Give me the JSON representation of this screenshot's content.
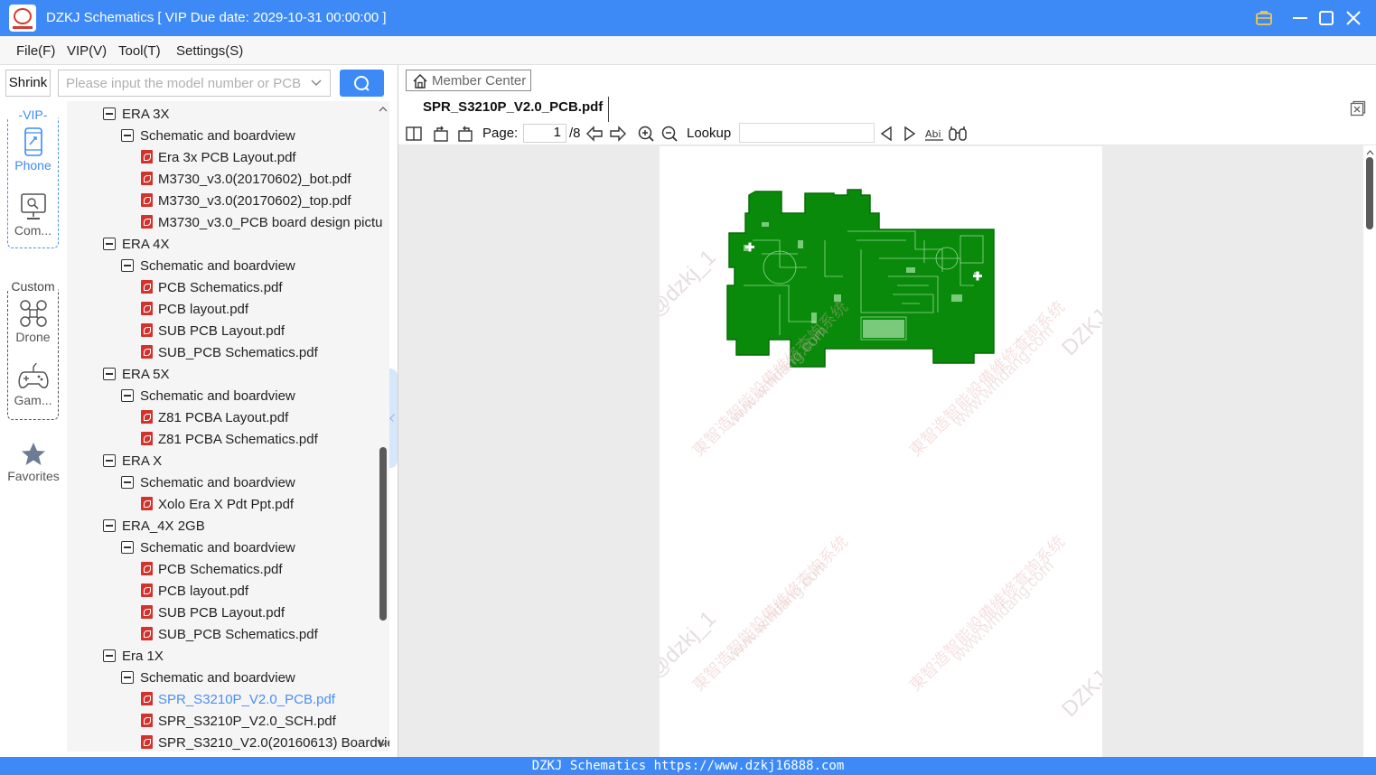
{
  "window": {
    "title": "DZKJ Schematics [ VIP Due date: 2029-10-31 00:00:00 ]",
    "accent_color": "#3d8af7"
  },
  "menu": [
    {
      "label": "File(F)"
    },
    {
      "label": "VIP(V)"
    },
    {
      "label": "Tool(T)"
    },
    {
      "label": "Settings(S)"
    }
  ],
  "toolbar": {
    "shrink_label": "Shrink",
    "search_placeholder": "Please input the model number or PCB",
    "search_value": ""
  },
  "sidenav": {
    "vip_group_label": "-VIP-",
    "custom_group_label": "Custom",
    "items": [
      {
        "label": "Phone",
        "icon": "phone-icon",
        "active": true
      },
      {
        "label": "Com...",
        "icon": "computer-icon"
      },
      {
        "label": "Drone",
        "icon": "drone-icon"
      },
      {
        "label": "Gam...",
        "icon": "gamepad-icon"
      },
      {
        "label": "Favorites",
        "icon": "star-icon"
      }
    ]
  },
  "tree": [
    {
      "label": "ERA 3X",
      "depth": 0,
      "type": "folder"
    },
    {
      "label": "Schematic and boardview",
      "depth": 1,
      "type": "folder"
    },
    {
      "label": "Era 3x PCB Layout.pdf",
      "depth": 2,
      "type": "pdf"
    },
    {
      "label": "M3730_v3.0(20170602)_bot.pdf",
      "depth": 2,
      "type": "pdf"
    },
    {
      "label": "M3730_v3.0(20170602)_top.pdf",
      "depth": 2,
      "type": "pdf"
    },
    {
      "label": "M3730_v3.0_PCB board design pictu",
      "depth": 2,
      "type": "pdf"
    },
    {
      "label": "ERA 4X",
      "depth": 0,
      "type": "folder"
    },
    {
      "label": "Schematic and boardview",
      "depth": 1,
      "type": "folder"
    },
    {
      "label": "PCB Schematics.pdf",
      "depth": 2,
      "type": "pdf"
    },
    {
      "label": "PCB layout.pdf",
      "depth": 2,
      "type": "pdf"
    },
    {
      "label": "SUB PCB Layout.pdf",
      "depth": 2,
      "type": "pdf"
    },
    {
      "label": "SUB_PCB Schematics.pdf",
      "depth": 2,
      "type": "pdf"
    },
    {
      "label": "ERA 5X",
      "depth": 0,
      "type": "folder"
    },
    {
      "label": "Schematic and boardview",
      "depth": 1,
      "type": "folder"
    },
    {
      "label": "Z81 PCBA Layout.pdf",
      "depth": 2,
      "type": "pdf"
    },
    {
      "label": "Z81 PCBA Schematics.pdf",
      "depth": 2,
      "type": "pdf"
    },
    {
      "label": "ERA X",
      "depth": 0,
      "type": "folder"
    },
    {
      "label": "Schematic and boardview",
      "depth": 1,
      "type": "folder"
    },
    {
      "label": "Xolo Era X Pdt Ppt.pdf",
      "depth": 2,
      "type": "pdf"
    },
    {
      "label": "ERA_4X 2GB",
      "depth": 0,
      "type": "folder"
    },
    {
      "label": "Schematic and boardview",
      "depth": 1,
      "type": "folder"
    },
    {
      "label": "PCB Schematics.pdf",
      "depth": 2,
      "type": "pdf"
    },
    {
      "label": "PCB layout.pdf",
      "depth": 2,
      "type": "pdf"
    },
    {
      "label": "SUB PCB Layout.pdf",
      "depth": 2,
      "type": "pdf"
    },
    {
      "label": "SUB_PCB Schematics.pdf",
      "depth": 2,
      "type": "pdf"
    },
    {
      "label": "Era 1X",
      "depth": 0,
      "type": "folder"
    },
    {
      "label": "Schematic and boardview",
      "depth": 1,
      "type": "folder"
    },
    {
      "label": "SPR_S3210P_V2.0_PCB.pdf",
      "depth": 2,
      "type": "pdf",
      "selected": true
    },
    {
      "label": "SPR_S3210P_V2.0_SCH.pdf",
      "depth": 2,
      "type": "pdf"
    },
    {
      "label": "SPR_S3210_V2.0(20160613) Boardvie",
      "depth": 2,
      "type": "pdf"
    }
  ],
  "viewer": {
    "member_center_label": "Member Center",
    "tab_label": "SPR_S3210P_V2.0_PCB.pdf",
    "page_label": "Page:",
    "page_current": "1",
    "page_total": "/8",
    "lookup_label": "Lookup",
    "lookup_value": "",
    "board_color": "#0a8a0a",
    "watermarks": [
      {
        "text": "DZKJ@dzkj_1",
        "kind": "id"
      },
      {
        "text": "東智造智能設備維修查詢系统",
        "kind": "cn"
      },
      {
        "text": "www.wmdang.com",
        "kind": "url"
      }
    ]
  },
  "statusbar": {
    "text": "DZKJ Schematics https://www.dzkj16888.com"
  }
}
